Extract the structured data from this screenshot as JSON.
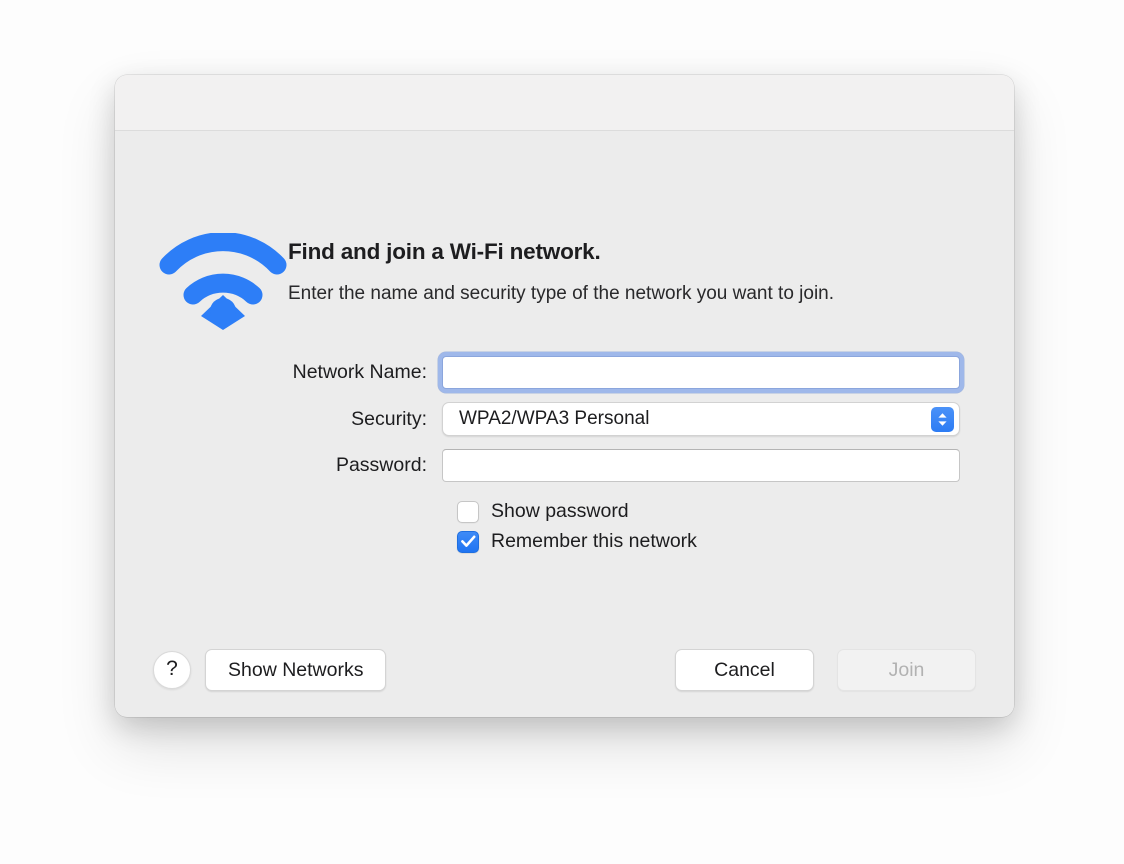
{
  "window": {
    "title": "",
    "accent_color": "#2c7cf4",
    "background_color": "#ececec",
    "titlebar_color": "#f2f1f1"
  },
  "header": {
    "icon": "wifi-icon",
    "title": "Find and join a Wi-Fi network.",
    "description": "Enter the name and security type of the network you want to join."
  },
  "form": {
    "network_name": {
      "label": "Network Name:",
      "value": "",
      "placeholder": "",
      "focused": true
    },
    "security": {
      "label": "Security:",
      "selected": "WPA2/WPA3 Personal",
      "stepper_icon": "chevron-up-down-icon"
    },
    "password": {
      "label": "Password:",
      "value": "",
      "placeholder": ""
    },
    "show_password": {
      "label": "Show password",
      "checked": false
    },
    "remember_network": {
      "label": "Remember this network",
      "checked": true
    }
  },
  "footer": {
    "help_label": "?",
    "show_networks_label": "Show Networks",
    "cancel_label": "Cancel",
    "join_label": "Join",
    "join_disabled": true
  }
}
